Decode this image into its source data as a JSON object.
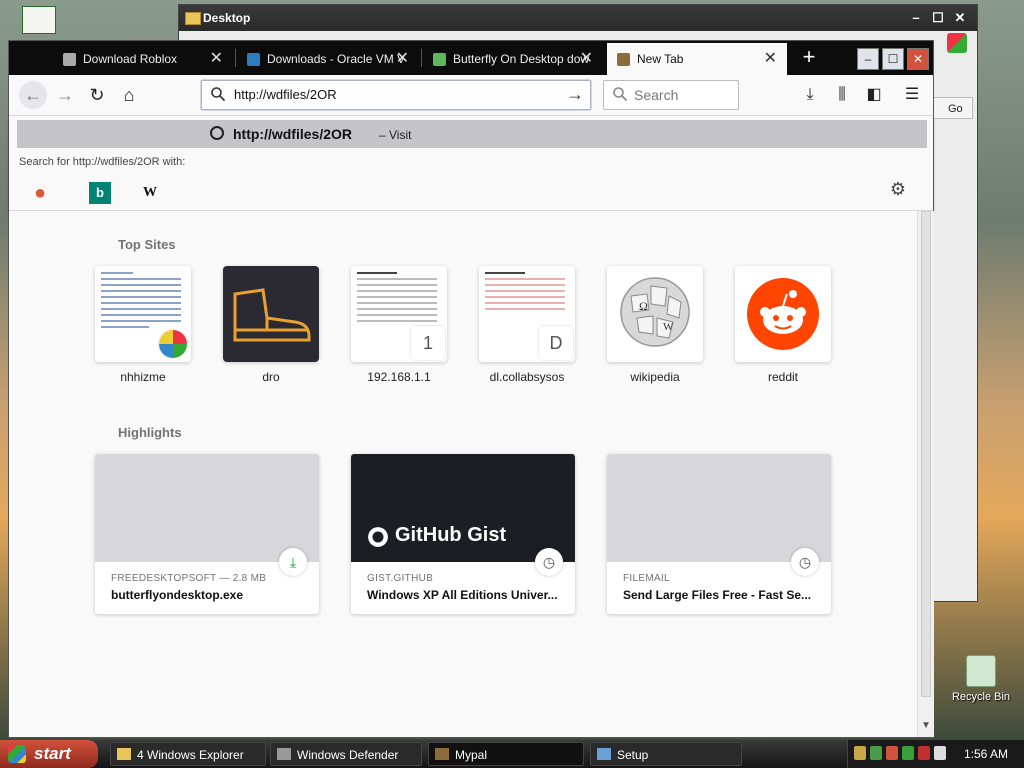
{
  "desktop": {
    "recycle_bin_label": "Recycle Bin"
  },
  "background_window": {
    "title": "Desktop",
    "go_label": "Go"
  },
  "browser": {
    "tabs": [
      {
        "label": "Download Roblox",
        "favicon_color": "#aaaaaa",
        "active": false
      },
      {
        "label": "Downloads - Oracle VM V",
        "favicon_color": "#2f7bc0",
        "active": false
      },
      {
        "label": "Butterfly On Desktop dow",
        "favicon_color": "#5cb85c",
        "active": false
      },
      {
        "label": "New Tab",
        "favicon_color": "#8a6d3b",
        "active": true
      }
    ],
    "url_value": "http://wdfiles/2OR",
    "search_placeholder": "Search",
    "dropdown": {
      "visit_url": "http://wdfiles/2OR",
      "visit_label": "– Visit",
      "search_with": "Search for http://wdfiles/2OR with:",
      "engines": [
        {
          "name": "duckduckgo",
          "glyph": "●",
          "color": "#de5833"
        },
        {
          "name": "bing",
          "glyph": "b",
          "color": "#008373"
        },
        {
          "name": "wikipedia",
          "glyph": "W",
          "color": "#111111"
        }
      ]
    },
    "newtab": {
      "top_sites_heading": "Top Sites",
      "top_sites": [
        {
          "label": "nhhizme",
          "badge": ""
        },
        {
          "label": "dro",
          "badge": ""
        },
        {
          "label": "192.168.1.1",
          "badge": "1"
        },
        {
          "label": "dl.collabsysos",
          "badge": "D"
        },
        {
          "label": "wikipedia",
          "badge": ""
        },
        {
          "label": "reddit",
          "badge": ""
        }
      ],
      "highlights_heading": "Highlights",
      "highlights": [
        {
          "meta": "FREEDESKTOPSOFT — 2.8 MB",
          "title": "butterflyondesktop.exe",
          "icon": "download-icon"
        },
        {
          "meta": "GIST.GITHUB",
          "title": "Windows XP All Editions Univer...",
          "image_text": "GitHub Gist",
          "icon": "clock-icon"
        },
        {
          "meta": "FILEMAIL",
          "title": "Send Large Files Free - Fast Se...",
          "icon": "clock-icon"
        }
      ]
    }
  },
  "taskbar": {
    "start_label": "start",
    "tasks": [
      {
        "label": "4 Windows Explorer"
      },
      {
        "label": "Windows Defender"
      },
      {
        "label": "Mypal"
      },
      {
        "label": "Setup"
      }
    ],
    "clock": "1:56 AM"
  }
}
